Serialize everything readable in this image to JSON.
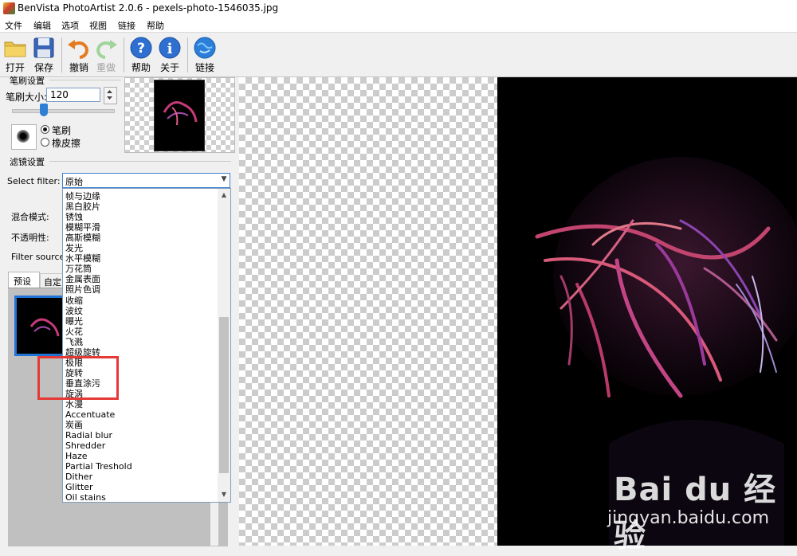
{
  "window": {
    "title": "BenVista PhotoArtist 2.0.6 - pexels-photo-1546035.jpg"
  },
  "menu": [
    "文件",
    "编辑",
    "选项",
    "视图",
    "链接",
    "帮助"
  ],
  "toolbar": {
    "open": "打开",
    "save": "保存",
    "undo": "撤销",
    "redo": "重做",
    "help": "帮助",
    "about": "关于",
    "link": "链接"
  },
  "brush_settings": {
    "title": "笔刷设置",
    "size_label": "笔刷大小:",
    "size_value": "120",
    "mode_brush": "笔刷",
    "mode_eraser": "橡皮擦",
    "selected_mode": "brush",
    "size_fraction": 0.3
  },
  "filter_settings": {
    "title": "滤镜设置",
    "select_label": "Select filter:",
    "selected": "原始",
    "blend_label": "混合模式:",
    "opacity_label": "不透明性:",
    "source_label": "Filter source:",
    "tab_preset": "预设",
    "tab_custom": "自定"
  },
  "dropdown_items": [
    "帧与边缘",
    "黑白胶片",
    "锈蚀",
    "模糊平滑",
    "高斯模糊",
    "发光",
    "水平模糊",
    "万花筒",
    "金属表面",
    "照片色调",
    "收缩",
    "波纹",
    "曝光",
    "火花",
    "飞溅",
    "超级旋转",
    "极限",
    "旋转",
    "垂直涂污",
    "旋涡",
    "水漫",
    "Accentuate",
    "炭画",
    "Radial blur",
    "Shredder",
    "Haze",
    "Partial Treshold",
    "Dither",
    "Glitter",
    "Oil stains"
  ],
  "watermark": {
    "logo": "Bai du 经验",
    "url": "jingyan.baidu.com"
  },
  "colors": {
    "accent": "#2d7fd6",
    "highlight": "#e53935",
    "canvas_bg": "#000000"
  }
}
